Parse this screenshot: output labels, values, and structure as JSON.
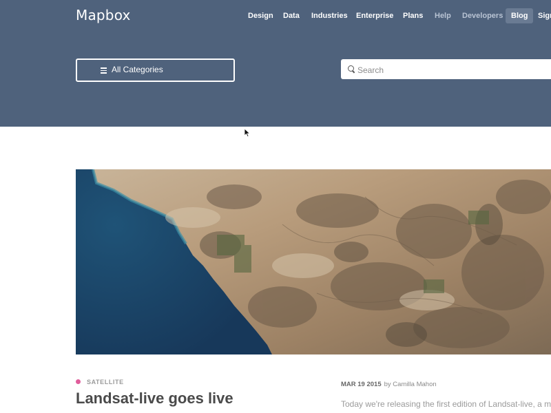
{
  "header": {
    "logo": "Mapbox",
    "nav": [
      {
        "label": "Design"
      },
      {
        "label": "Data"
      },
      {
        "label": "Industries"
      },
      {
        "label": "Enterprise"
      },
      {
        "label": "Plans"
      },
      {
        "label": "Help"
      },
      {
        "label": "Developers"
      },
      {
        "label": "Blog",
        "active": true
      },
      {
        "label": "Sign"
      }
    ]
  },
  "filters": {
    "categories_label": "All Categories",
    "search_placeholder": "Search"
  },
  "post": {
    "category": "SATELLITE",
    "title": "Landsat-live goes live",
    "date": "MAR 19 2015",
    "author": "by Camilla Mahon",
    "excerpt": "Today we're releasing the first edition of Landsat-live, a m"
  },
  "colors": {
    "header_bg": "#4f627c",
    "category_dot": "#e05d9b"
  }
}
